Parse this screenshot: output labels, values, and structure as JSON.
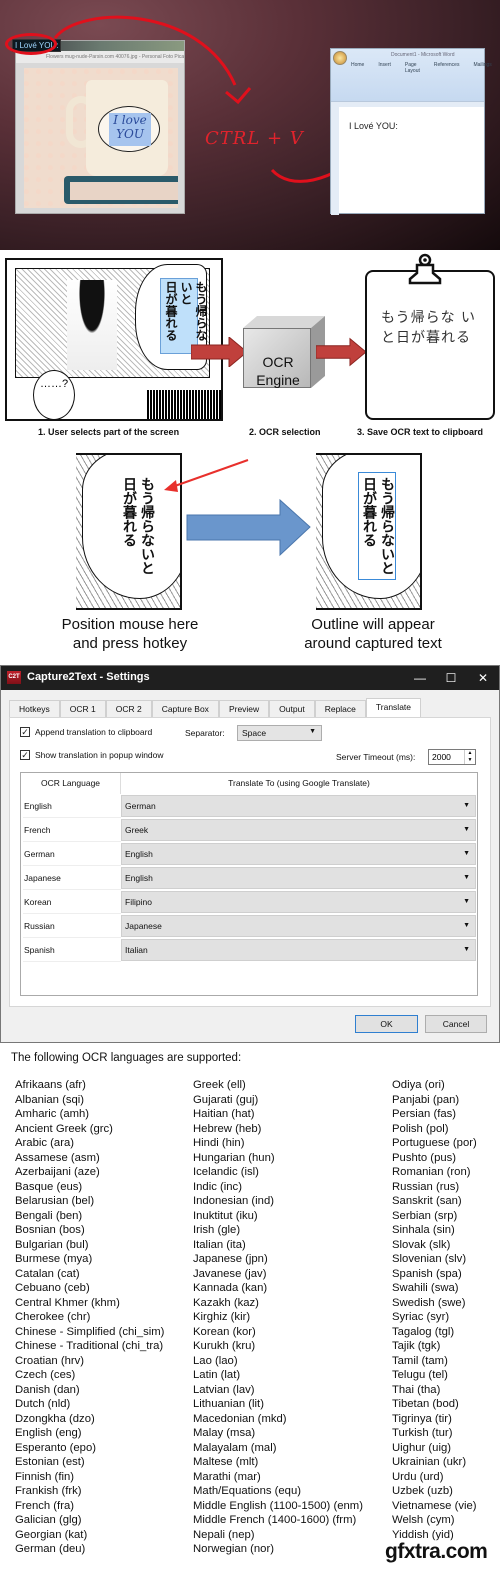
{
  "hero": {
    "captured_text": "I Lové YOU:",
    "mug_text_line1": "I love",
    "mug_text_line2": "YOU",
    "photo_window_title": "Flowers mug-nude-Parsin.com 40076.jpg - Personal Foto Picasa",
    "shortcut_label": "CTRL + V",
    "word_title": "Document1 - Microsoft Word",
    "word_tabs": [
      "Home",
      "Insert",
      "Page Layout",
      "References",
      "Mailings"
    ],
    "word_pasted_text": "I Lové YOU:",
    "accent_color": "#e0101c"
  },
  "flow": {
    "selected_text_vertical": "もう帰らないと日が暮れる",
    "selected_col1": "もう帰らないと",
    "selected_col2": "日が暮れる",
    "ellipsis_bubble": "……?",
    "engine_label_line1": "OCR",
    "engine_label_line2": "Engine",
    "clipboard_line1": "もう帰らな い",
    "clipboard_line2": "と日が暮れる",
    "captions": [
      "1. User selects part of the screen",
      "2. OCR selection",
      "3. Save OCR text to clipboard"
    ]
  },
  "demo": {
    "col1": "もう帰らないと",
    "col2": "日が暮れる",
    "left_caption_line1": "Position mouse here",
    "left_caption_line2": "and press hotkey",
    "right_caption_line1": "Outline will appear",
    "right_caption_line2": "around captured text",
    "outline_color": "#3a8ad8",
    "arrow_color": "#6a96cc"
  },
  "dialog": {
    "title": "Capture2Text - Settings",
    "icon_text": "C2T",
    "controls": {
      "minimize": "—",
      "maximize": "☐",
      "close": "✕"
    },
    "tabs": [
      "Hotkeys",
      "OCR 1",
      "OCR 2",
      "Capture Box",
      "Preview",
      "Output",
      "Replace",
      "Translate"
    ],
    "active_tab": "Translate",
    "append_translation": {
      "label": "Append translation to clipboard",
      "checked": true
    },
    "show_popup": {
      "label": "Show translation in popup window",
      "checked": true
    },
    "separator": {
      "label": "Separator:",
      "value": "Space"
    },
    "server_timeout": {
      "label": "Server Timeout (ms):",
      "value": "2000"
    },
    "grid": {
      "headers": [
        "OCR Language",
        "Translate To (using Google Translate)"
      ],
      "rows": [
        {
          "ocr": "English",
          "target": "German"
        },
        {
          "ocr": "French",
          "target": "Greek"
        },
        {
          "ocr": "German",
          "target": "English"
        },
        {
          "ocr": "Japanese",
          "target": "English"
        },
        {
          "ocr": "Korean",
          "target": "Filipino"
        },
        {
          "ocr": "Russian",
          "target": "Japanese"
        },
        {
          "ocr": "Spanish",
          "target": "Italian"
        }
      ]
    },
    "ok_label": "OK",
    "cancel_label": "Cancel"
  },
  "languages": {
    "heading": "The following OCR languages are supported:",
    "columns": [
      [
        "Afrikaans (afr)",
        "Albanian (sqi)",
        "Amharic (amh)",
        "Ancient Greek (grc)",
        "Arabic (ara)",
        "Assamese (asm)",
        "Azerbaijani (aze)",
        "Basque (eus)",
        "Belarusian (bel)",
        "Bengali (ben)",
        "Bosnian (bos)",
        "Bulgarian (bul)",
        "Burmese (mya)",
        "Catalan (cat)",
        "Cebuano (ceb)",
        "Central Khmer (khm)",
        "Cherokee (chr)",
        "Chinese - Simplified (chi_sim)",
        "Chinese - Traditional (chi_tra)",
        "Croatian (hrv)",
        "Czech (ces)",
        "Danish (dan)",
        "Dutch (nld)",
        "Dzongkha (dzo)",
        "English (eng)",
        "Esperanto (epo)",
        "Estonian (est)",
        "Finnish (fin)",
        "Frankish (frk)",
        "French (fra)",
        "Galician (glg)",
        "Georgian (kat)",
        "German (deu)"
      ],
      [
        "Greek (ell)",
        "Gujarati (guj)",
        "Haitian (hat)",
        "Hebrew (heb)",
        "Hindi (hin)",
        "Hungarian (hun)",
        "Icelandic (isl)",
        "Indic (inc)",
        "Indonesian (ind)",
        "Inuktitut (iku)",
        "Irish (gle)",
        "Italian (ita)",
        "Japanese (jpn)",
        "Javanese (jav)",
        "Kannada (kan)",
        "Kazakh (kaz)",
        "Kirghiz (kir)",
        "Korean (kor)",
        "Kurukh (kru)",
        "Lao (lao)",
        "Latin (lat)",
        "Latvian (lav)",
        "Lithuanian (lit)",
        "Macedonian (mkd)",
        "Malay (msa)",
        "Malayalam (mal)",
        "Maltese (mlt)",
        "Marathi (mar)",
        "Math/Equations (equ)",
        "Middle English (1100-1500) (enm)",
        "Middle French (1400-1600) (frm)",
        "Nepali (nep)",
        "Norwegian (nor)"
      ],
      [
        "Odiya (ori)",
        "Panjabi (pan)",
        "Persian (fas)",
        "Polish (pol)",
        "Portuguese (por)",
        "Pushto (pus)",
        "Romanian (ron)",
        "Russian (rus)",
        "Sanskrit (san)",
        "Serbian (srp)",
        "Sinhala (sin)",
        "Slovak (slk)",
        "Slovenian (slv)",
        "Spanish (spa)",
        "Swahili (swa)",
        "Swedish (swe)",
        "Syriac (syr)",
        "Tagalog (tgl)",
        "Tajik (tgk)",
        "Tamil (tam)",
        "Telugu (tel)",
        "Thai (tha)",
        "Tibetan (bod)",
        "Tigrinya (tir)",
        "Turkish (tur)",
        "Uighur (uig)",
        "Ukrainian (ukr)",
        "Urdu (urd)",
        "Uzbek (uzb)",
        "Vietnamese (vie)",
        "Welsh (cym)",
        "Yiddish (yid)"
      ]
    ]
  },
  "watermark": "gfxtra.com"
}
